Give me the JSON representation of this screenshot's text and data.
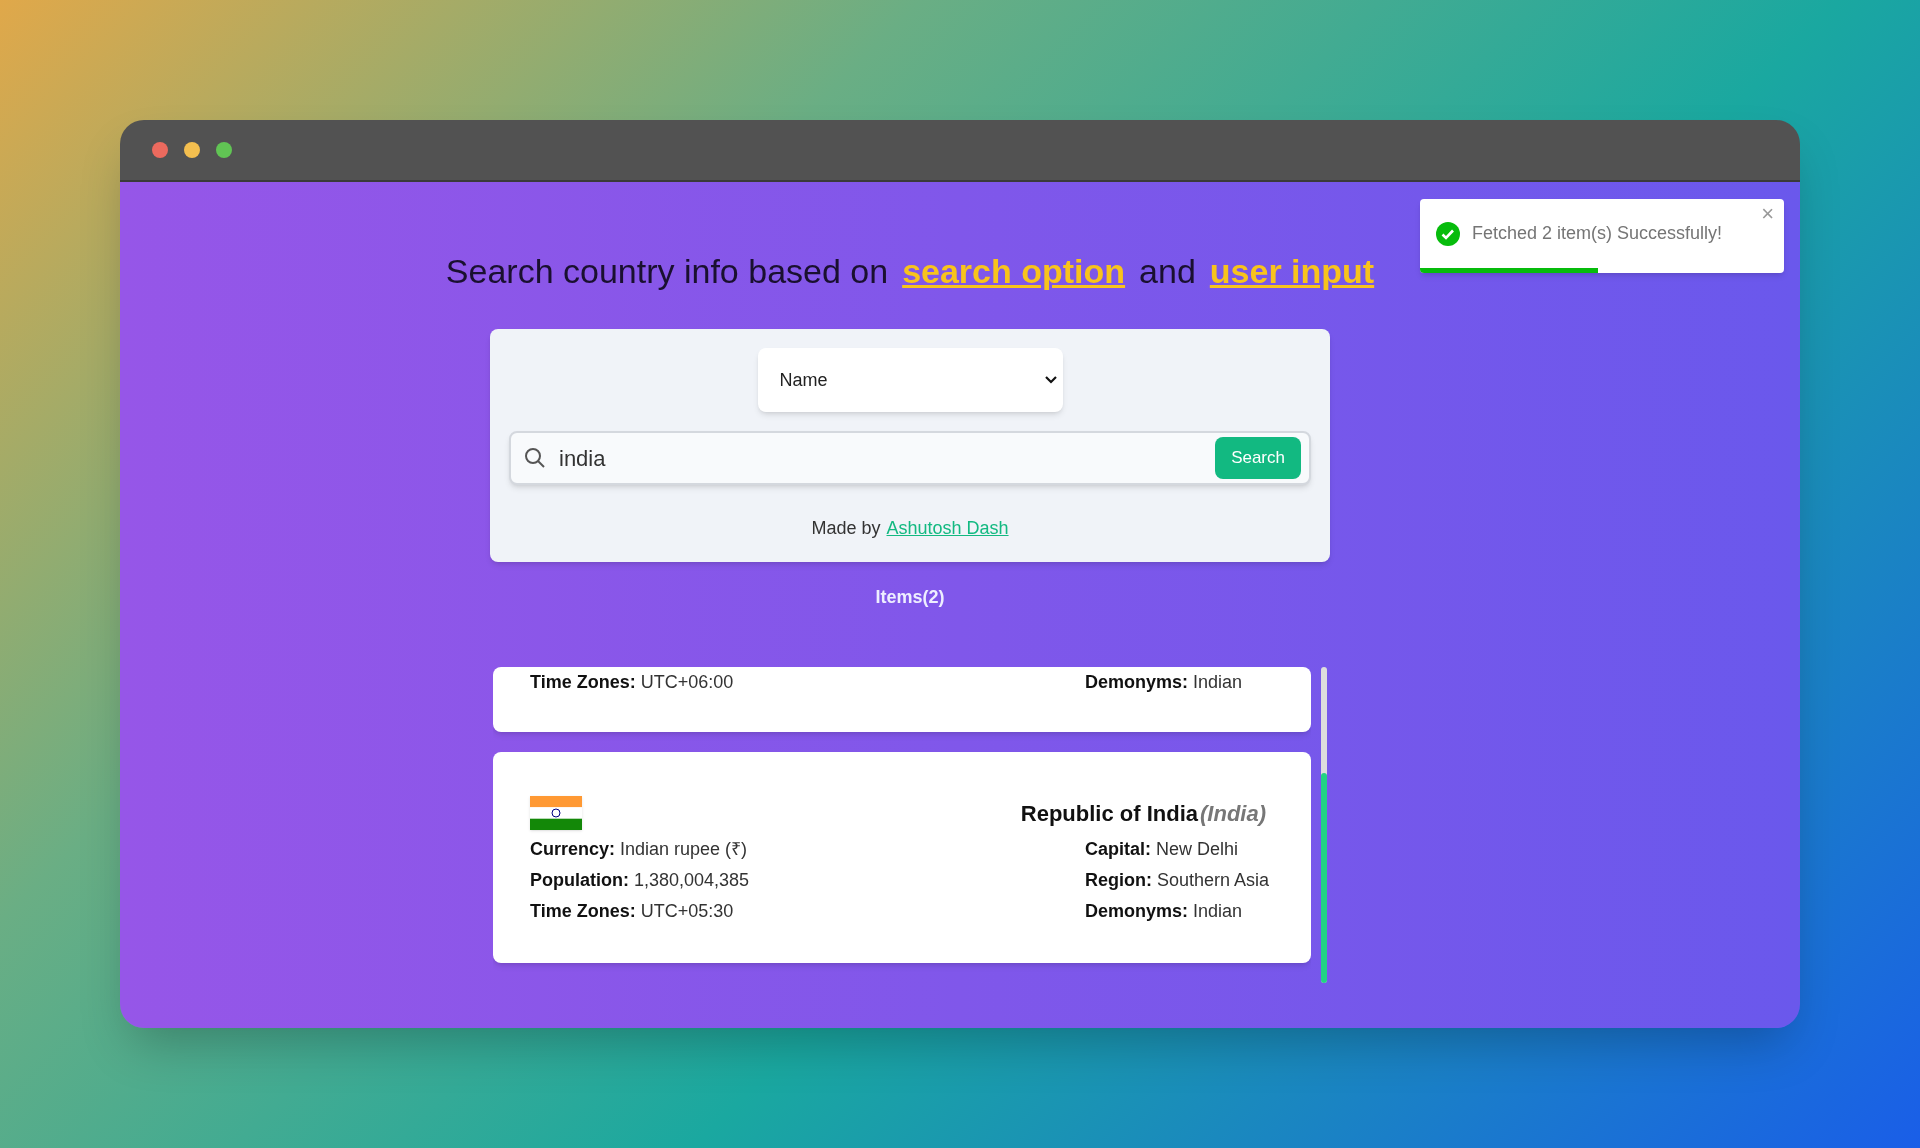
{
  "heading": [
    {
      "text": "Search country info based on",
      "highlight": false
    },
    {
      "text": "search option",
      "highlight": true
    },
    {
      "text": "and",
      "highlight": false
    },
    {
      "text": "user input",
      "highlight": true
    }
  ],
  "search_option": {
    "value": "Name"
  },
  "search": {
    "value": "india",
    "button": "Search"
  },
  "credit": {
    "text": "Made by",
    "link": "Ashutosh Dash"
  },
  "items_count": "Items(2)",
  "results": [
    {
      "fields_left": [
        {
          "label": "Time Zones:",
          "value": "UTC+06:00"
        }
      ],
      "fields_right": [
        {
          "label": "Demonyms:",
          "value": "Indian"
        }
      ]
    },
    {
      "flag": true,
      "official_name": "Republic of India",
      "common_name": "(India)",
      "fields_left": [
        {
          "label": "Currency:",
          "value": "Indian rupee (₹)"
        },
        {
          "label": "Population:",
          "value": "1,380,004,385"
        },
        {
          "label": "Time Zones:",
          "value": "UTC+05:30"
        }
      ],
      "fields_right": [
        {
          "label": "Capital:",
          "value": "New Delhi"
        },
        {
          "label": "Region:",
          "value": "Southern Asia"
        },
        {
          "label": "Demonyms:",
          "value": "Indian"
        }
      ]
    }
  ],
  "toast": {
    "message": "Fetched 2 item(s) Successfully!",
    "close": "×",
    "level": 0.49
  }
}
